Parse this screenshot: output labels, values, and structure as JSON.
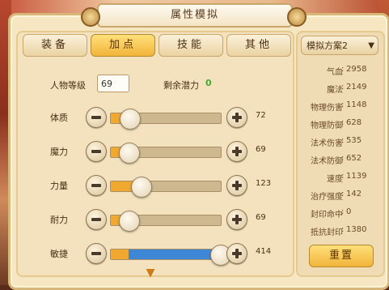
{
  "window": {
    "title": "属性模拟"
  },
  "tabs": [
    {
      "label": "装备",
      "active": false
    },
    {
      "label": "加点",
      "active": true
    },
    {
      "label": "技能",
      "active": false
    },
    {
      "label": "其他",
      "active": false
    }
  ],
  "level": {
    "label": "人物等级",
    "value": "69"
  },
  "remaining": {
    "label": "剩余潜力",
    "value": "0"
  },
  "attributes": [
    {
      "label": "体质",
      "value": "72",
      "fill_fraction": 0.17,
      "extra_fraction": 0
    },
    {
      "label": "魔力",
      "value": "69",
      "fill_fraction": 0.16,
      "extra_fraction": 0
    },
    {
      "label": "力量",
      "value": "123",
      "fill_fraction": 0.27,
      "extra_fraction": 0
    },
    {
      "label": "耐力",
      "value": "69",
      "fill_fraction": 0.16,
      "extra_fraction": 0
    },
    {
      "label": "敏捷",
      "value": "414",
      "fill_fraction": 0.16,
      "extra_fraction": 0.83
    }
  ],
  "icons": {
    "minus": "minus-icon",
    "plus": "plus-icon",
    "expand": "chevron-down-icon"
  },
  "side": {
    "plan": "模拟方案2",
    "stats": [
      {
        "label": "气血",
        "value": "2958"
      },
      {
        "label": "魔法",
        "value": "2149"
      },
      {
        "label": "物理伤害",
        "value": "1148"
      },
      {
        "label": "物理防御",
        "value": "628"
      },
      {
        "label": "法术伤害",
        "value": "535"
      },
      {
        "label": "法术防御",
        "value": "652"
      },
      {
        "label": "速度",
        "value": "1139"
      },
      {
        "label": "治疗强度",
        "value": "142"
      },
      {
        "label": "封印命中",
        "value": "0"
      },
      {
        "label": "抵抗封印",
        "value": "1380"
      }
    ],
    "reset_label": "重置"
  },
  "colors": {
    "accent": "#f2b43a",
    "fill_orange": "#f0a830",
    "fill_blue": "#3e86d6",
    "remaining_green": "#3fae2f"
  }
}
